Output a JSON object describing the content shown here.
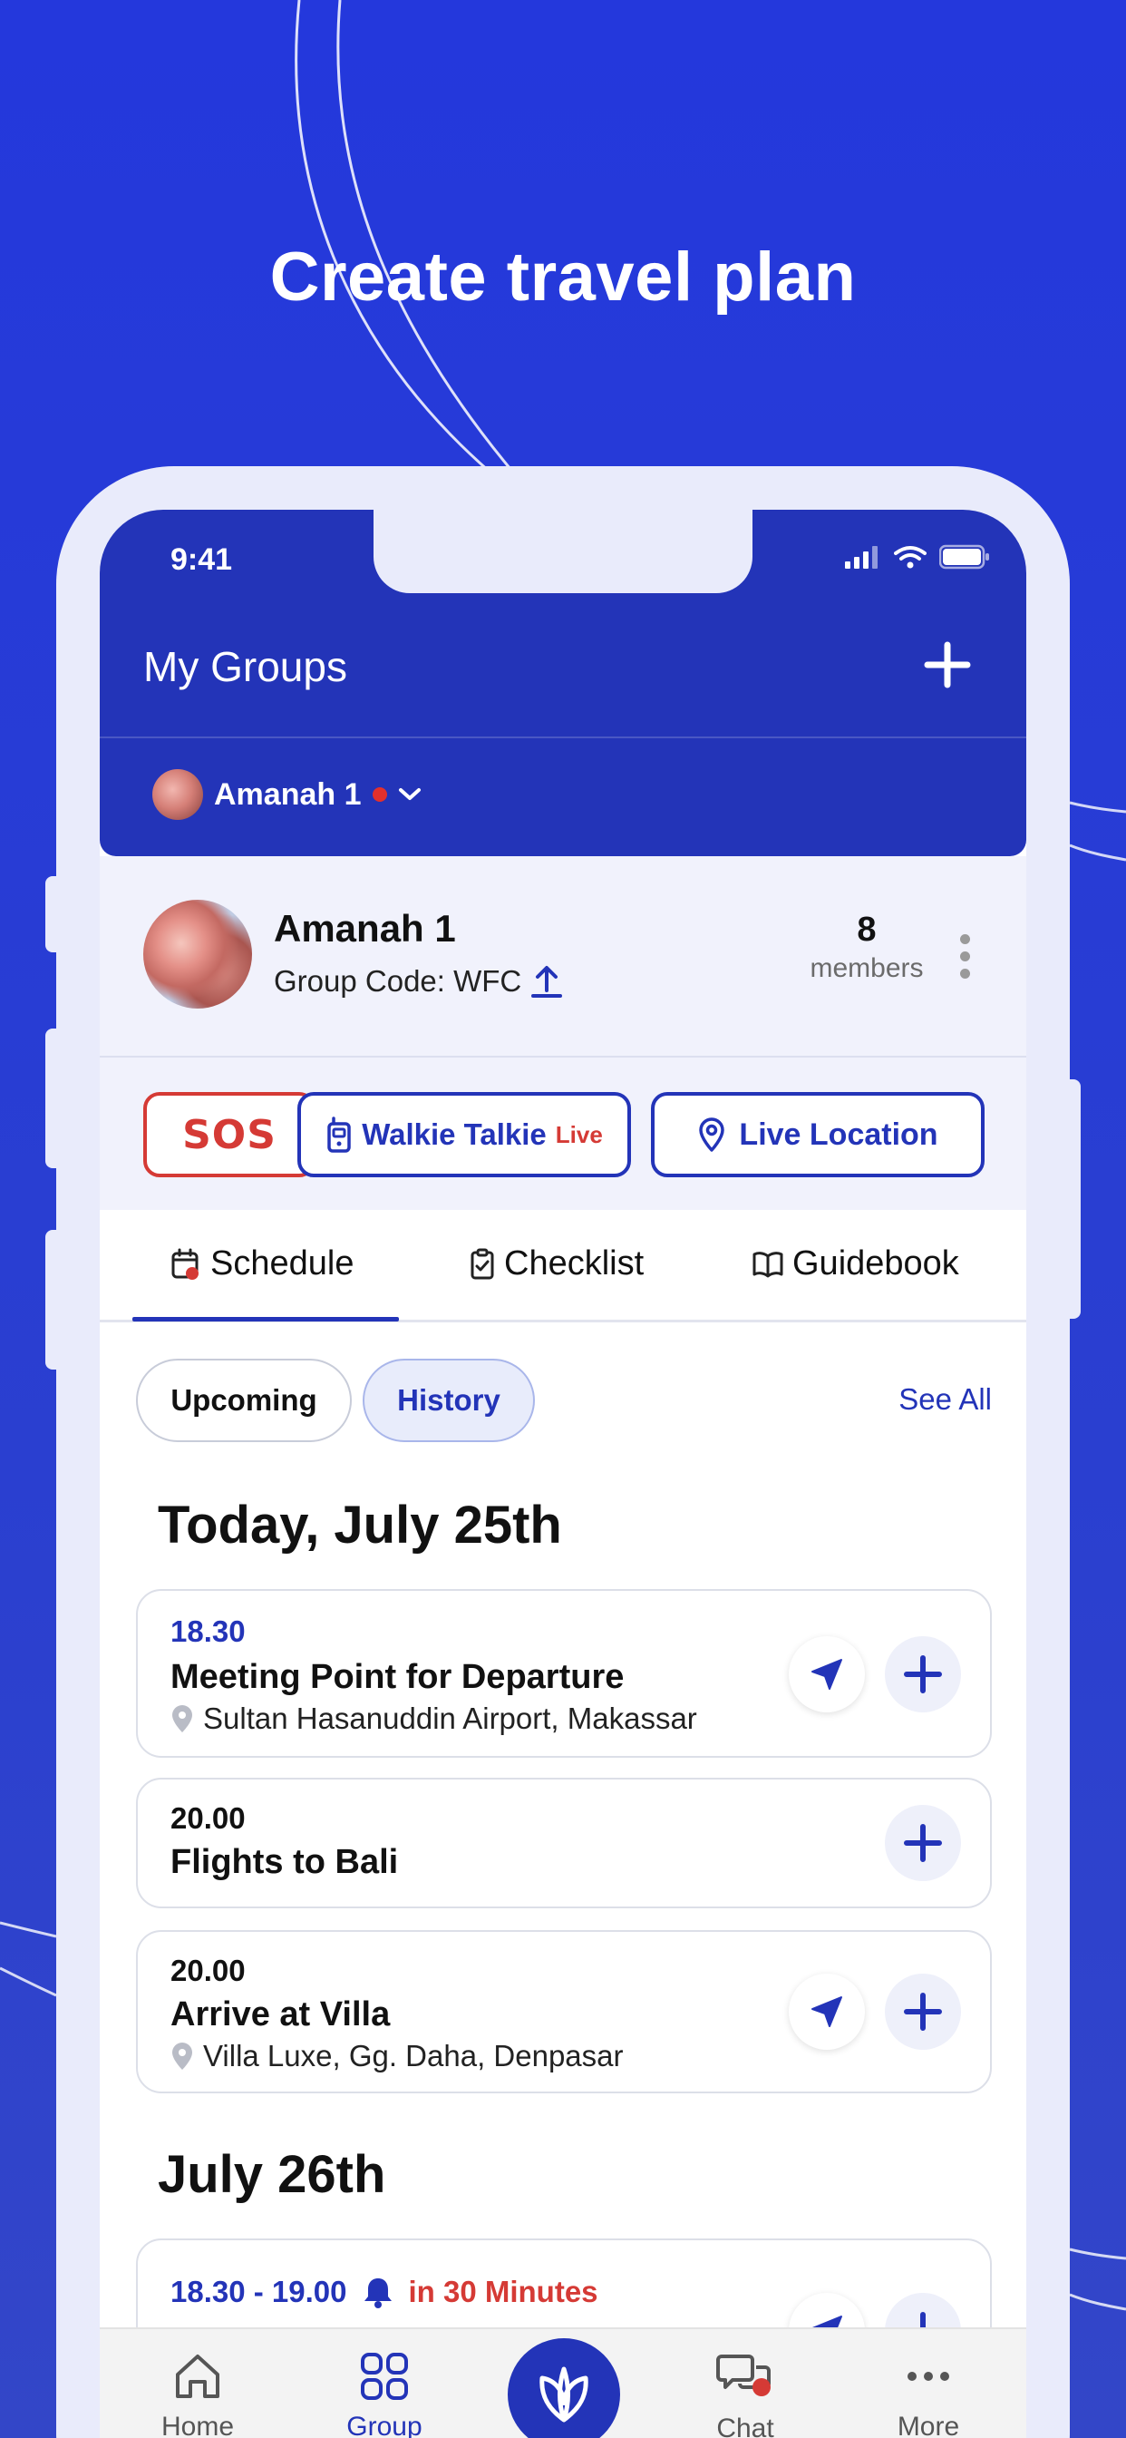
{
  "headline": "Create travel plan",
  "status_bar": {
    "time": "9:41"
  },
  "header": {
    "title": "My Groups",
    "selected_group": "Amanah 1"
  },
  "group": {
    "name": "Amanah 1",
    "code_label": "Group Code: WFC",
    "member_count": "8",
    "member_label": "members"
  },
  "actions": {
    "sos": "SOS",
    "walkie": "Walkie Talkie",
    "walkie_live": "Live",
    "location": "Live Location"
  },
  "tabs": [
    {
      "label": "Schedule",
      "icon": "calendar-icon",
      "active": true
    },
    {
      "label": "Checklist",
      "icon": "clipboard-check-icon",
      "active": false
    },
    {
      "label": "Guidebook",
      "icon": "book-icon",
      "active": false
    }
  ],
  "filters": {
    "upcoming": "Upcoming",
    "history": "History",
    "see_all": "See All"
  },
  "days": [
    {
      "heading": "Today, July 25th",
      "events": [
        {
          "time": "18.30",
          "title": "Meeting Point for Departure",
          "location": "Sultan Hasanuddin Airport, Makassar"
        },
        {
          "time": "20.00",
          "title": "Flights to Bali",
          "location": ""
        },
        {
          "time": "20.00",
          "title": "Arrive at Villa",
          "location": "Villa Luxe, Gg. Daha, Denpasar"
        }
      ]
    },
    {
      "heading": "July 26th",
      "events": [
        {
          "time": "18.30 - 19.00",
          "reminder": "in 30 Minutes"
        }
      ]
    }
  ],
  "bottom_nav": {
    "home": "Home",
    "group": "Group",
    "chat": "Chat",
    "more": "More"
  },
  "colors": {
    "background": "#2437d6",
    "primary": "#2334b8",
    "alert": "#d53a35",
    "phone_frame": "#e9ebfb"
  }
}
